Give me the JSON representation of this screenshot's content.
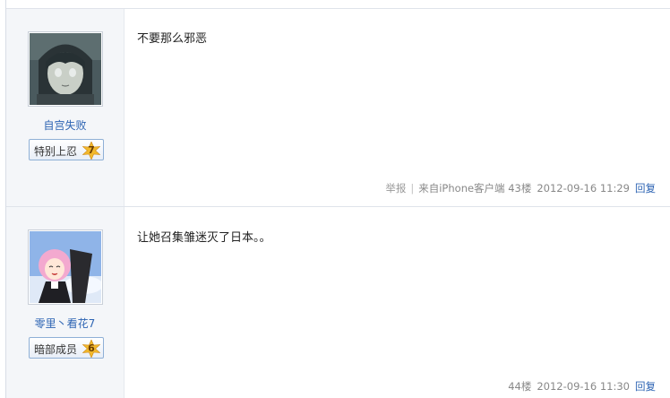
{
  "posts": [
    {
      "username": "自宫失败",
      "rank": "特别上忍",
      "level": "7",
      "content": "不要那么邪恶",
      "report": "举报",
      "source": "来自iPhone客户端",
      "floor": "43楼",
      "time": "2012-09-16 11:29",
      "reply": "回复"
    },
    {
      "username": "零里丶看花7",
      "rank": "暗部成员",
      "level": "6",
      "content": "让她召集雏迷灭了日本。。",
      "floor": "44楼",
      "time": "2012-09-16 11:30",
      "reply": "回复"
    }
  ],
  "colors": {
    "link": "#2d64b3",
    "sidebar_bg": "#f4f6f9",
    "level_badge": "#f2b92c"
  }
}
